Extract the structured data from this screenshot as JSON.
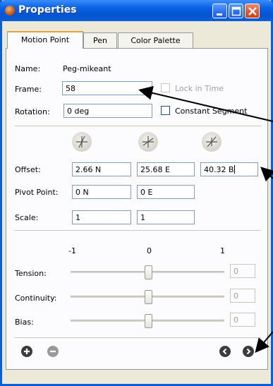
{
  "window": {
    "title": "Properties",
    "accent": "#0a5fd8"
  },
  "tabs": [
    {
      "label": "Motion Point",
      "active": true
    },
    {
      "label": "Pen",
      "active": false
    },
    {
      "label": "Color Palette",
      "active": false
    }
  ],
  "fields": {
    "name_label": "Name:",
    "name_value": "Peg-mikeant",
    "frame_label": "Frame:",
    "frame_value": "58",
    "lock_in_time_label": "Lock in Time",
    "rotation_label": "Rotation:",
    "rotation_value": "0 deg",
    "constant_segment_label": "Constant Segment"
  },
  "offset": {
    "label": "Offset:",
    "x": "2.66 N",
    "y": "25.68 E",
    "z": "40.32 B"
  },
  "pivot": {
    "label": "Pivot Point:",
    "x": "0 N",
    "y": "0 E"
  },
  "scale": {
    "label": "Scale:",
    "x": "1",
    "y": "1"
  },
  "sliders": {
    "scale_min": "-1",
    "scale_mid": "0",
    "scale_max": "1",
    "tension": {
      "label": "Tension:",
      "value": "0"
    },
    "continuity": {
      "label": "Continuity:",
      "value": "0"
    },
    "bias": {
      "label": "Bias:",
      "value": "0"
    }
  },
  "icons": [
    "add-icon",
    "remove-icon",
    "previous-icon",
    "next-icon",
    "axis-knob-icon"
  ]
}
